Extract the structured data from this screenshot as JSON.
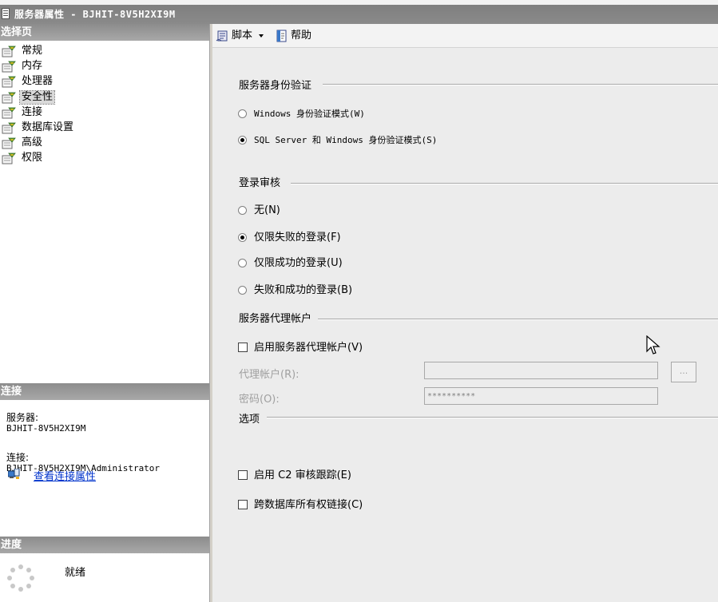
{
  "window": {
    "title": "服务器属性 - BJHIT-8V5H2XI9M"
  },
  "left": {
    "pages_header": "选择页",
    "pages": [
      {
        "label": "常规"
      },
      {
        "label": "内存"
      },
      {
        "label": "处理器"
      },
      {
        "label": "安全性",
        "selected": true
      },
      {
        "label": "连接"
      },
      {
        "label": "数据库设置"
      },
      {
        "label": "高级"
      },
      {
        "label": "权限"
      }
    ],
    "connection_header": "连接",
    "server_label": "服务器:",
    "server_value": "BJHIT-8V5H2XI9M",
    "connection_label": "连接:",
    "connection_value": "BJHIT-8V5H2XI9M\\Administrator",
    "view_link": "查看连接属性",
    "progress_header": "进度",
    "progress_status": "就绪"
  },
  "toolbar": {
    "script_label": "脚本",
    "help_label": "帮助"
  },
  "security": {
    "auth_group": "服务器身份验证",
    "auth_windows": "Windows 身份验证模式(W)",
    "auth_mixed": "SQL Server 和 Windows 身份验证模式(S)",
    "auth_selected": "mixed",
    "audit_group": "登录审核",
    "audit_none": "无(N)",
    "audit_failed": "仅限失败的登录(F)",
    "audit_success": "仅限成功的登录(U)",
    "audit_both": "失败和成功的登录(B)",
    "audit_selected": "failed",
    "proxy_group": "服务器代理帐户",
    "proxy_enable": "启用服务器代理帐户(V)",
    "proxy_account_label": "代理帐户(R):",
    "proxy_account_value": "",
    "password_label": "密码(O):",
    "password_value": "**********",
    "browse_label": "...",
    "options_group": "选项",
    "c2_audit": "启用 C2 审核跟踪(E)",
    "cross_db": "跨数据库所有权链接(C)"
  },
  "colors": {
    "header_bg": "#9a9a9a",
    "pane_bg": "#ececec",
    "link": "#0033cc"
  }
}
